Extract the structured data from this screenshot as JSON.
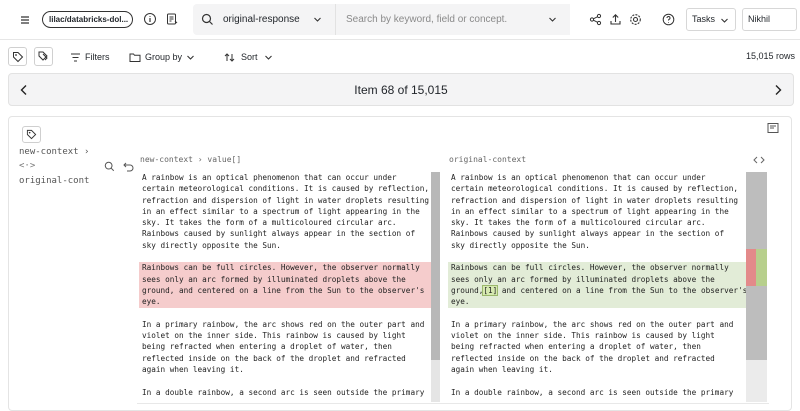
{
  "topbar": {
    "dataset_name": "lilac/databricks-dol...",
    "field_select_value": "original-response",
    "search_placeholder": "Search by keyword, field or concept.",
    "tasks_label": "Tasks",
    "user_label": "Nikhil"
  },
  "toolbar": {
    "filters_label": "Filters",
    "groupby_label": "Group by",
    "sort_label": "Sort",
    "row_count": "15,015 rows"
  },
  "navigator": {
    "label": "Item 68 of 15,015"
  },
  "item": {
    "path": {
      "left_field": "new-context ›",
      "code_glyph": "<·>",
      "right_field": "original-cont"
    },
    "diff": {
      "left_label": "new-context › value[]",
      "right_label": "original-context",
      "left_paragraphs": [
        "A rainbow is an optical phenomenon that can occur under\ncertain meteorological conditions. It is caused by reflection,\nrefraction and dispersion of light in water droplets resulting\nin an effect similar to a spectrum of light appearing in the\nsky. It takes the form of a multicoloured circular arc.\nRainbows caused by sunlight always appear in the section of\nsky directly opposite the Sun.",
        "Rainbows can be full circles. However, the observer normally\nsees only an arc formed by illuminated droplets above the\nground, and centered on a line from the Sun to the observer's\neye.",
        "In a primary rainbow, the arc shows red on the outer part and\nviolet on the inner side. This rainbow is caused by light\nbeing refracted when entering a droplet of water, then\nreflected inside on the back of the droplet and refracted\nagain when leaving it.",
        "In a double rainbow, a second arc is seen outside the primary"
      ],
      "right_paragraphs": [
        "A rainbow is an optical phenomenon that can occur under\ncertain meteorological conditions. It is caused by reflection,\nrefraction and dispersion of light in water droplets resulting\nin an effect similar to a spectrum of light appearing in the\nsky. It takes the form of a multicoloured circular arc.\nRainbows caused by sunlight always appear in the section of\nsky directly opposite the Sun.",
        "Rainbows can be full circles. However, the observer normally\nsees only an arc formed by illuminated droplets above the",
        "ground,",
        "[1]",
        " and centered on a line from the Sun to the observer's\neye.",
        "In a primary rainbow, the arc shows red on the outer part and\nviolet on the inner side. This rainbow is caused by light\nbeing refracted when entering a droplet of water, then\nreflected inside on the back of the droplet and refracted\nagain when leaving it.",
        "In a double rainbow, a second arc is seen outside the primary"
      ]
    }
  },
  "colors": {
    "removed_bg": "#f5cccc",
    "added_bg": "#e2ecd7",
    "nav_bg": "#f4f4f5"
  }
}
